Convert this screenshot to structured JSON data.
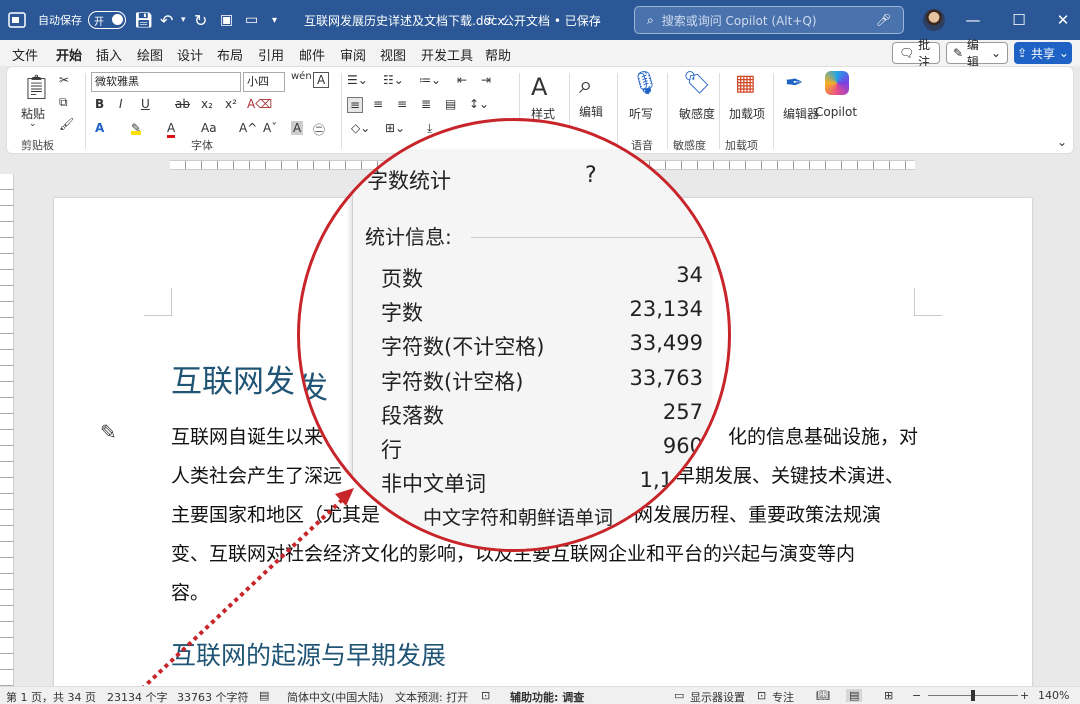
{
  "titlebar": {
    "autosave_label": "自动保存",
    "autosave_state": "开",
    "filename": "互联网发展历史详述及文档下载.docx",
    "security": "公开文档 • 已保存",
    "search_placeholder": "搜索或询问 Copilot (Alt+Q)"
  },
  "menu": {
    "tabs": [
      "文件",
      "开始",
      "插入",
      "绘图",
      "设计",
      "布局",
      "引用",
      "邮件",
      "审阅",
      "视图",
      "开发工具",
      "帮助"
    ],
    "active": "开始",
    "comment_btn": "批注",
    "edit_btn": "编辑",
    "share_btn": "共享"
  },
  "ribbon": {
    "paste": "粘贴",
    "clipboard": "剪贴板",
    "font_name": "微软雅黑",
    "font_size": "小四",
    "font_group": "字体",
    "styles": "样式",
    "editing": "编辑",
    "dictate": "听写",
    "voice": "语音",
    "sensitivity": "敏感度",
    "sensitivity_btn": "敏感度",
    "addins": "加载项",
    "addins_btn": "加载项",
    "editor": "编辑器",
    "copilot": "Copilot"
  },
  "document": {
    "heading": "互联网发",
    "paragraph_lines": [
      "互联网自诞生以来",
      "人类社会产生了深远",
      "主要国家和地区（尤其是",
      "变、互联网对社会经济文化的影响，以及主要互联网企业和平台的兴起与演变等内",
      "容。"
    ],
    "paragraph_right": [
      "化的信息基础设施，对",
      "早期发展、关键技术演进、",
      "网发展历程、重要政策法规演"
    ],
    "section_heading": "互联网的起源与早期发展"
  },
  "dialog": {
    "title": "字数统计",
    "help": "?",
    "section": "统计信息:",
    "rows": [
      {
        "label": "页数",
        "value": "34"
      },
      {
        "label": "字数",
        "value": "23,134"
      },
      {
        "label": "字符数(不计空格)",
        "value": "33,499"
      },
      {
        "label": "字符数(计空格)",
        "value": "33,763"
      },
      {
        "label": "段落数",
        "value": "257"
      },
      {
        "label": "行",
        "value": "960"
      },
      {
        "label": "非中文单词",
        "value": "1,1"
      },
      {
        "label": "中文字符和朝鲜语单词",
        "value": ""
      }
    ]
  },
  "status": {
    "page": "第 1 页，共 34 页",
    "words": "23134 个字",
    "chars": "33763 个字符",
    "lang": "简体中文(中国大陆)",
    "predict": "文本预测: 打开",
    "access": "辅助功能: 调查",
    "display": "显示器设置",
    "focus": "专注",
    "zoom": "140%"
  },
  "colors": {
    "titlebar": "#2b5796",
    "accent": "#185abd",
    "heading": "#1f5475",
    "highlight": "#c8252b"
  }
}
